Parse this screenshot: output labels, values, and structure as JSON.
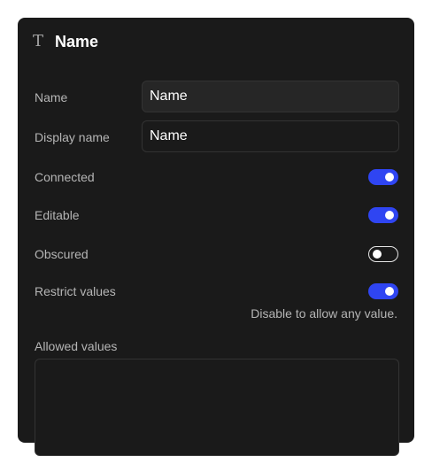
{
  "panel": {
    "icon": "text-type-icon",
    "title": "Name"
  },
  "fields": {
    "name": {
      "label": "Name",
      "value": "Name"
    },
    "display_name": {
      "label": "Display name",
      "value": "Name"
    }
  },
  "toggles": {
    "connected": {
      "label": "Connected",
      "on": true
    },
    "editable": {
      "label": "Editable",
      "on": true
    },
    "obscured": {
      "label": "Obscured",
      "on": false
    },
    "restrict_values": {
      "label": "Restrict values",
      "on": true,
      "hint": "Disable to allow any value."
    }
  },
  "allowed_values": {
    "label": "Allowed values",
    "value": ""
  },
  "colors": {
    "panel_bg": "#1a1a1a",
    "toggle_on": "#2f45f2",
    "label_text": "#b5b5b5"
  }
}
